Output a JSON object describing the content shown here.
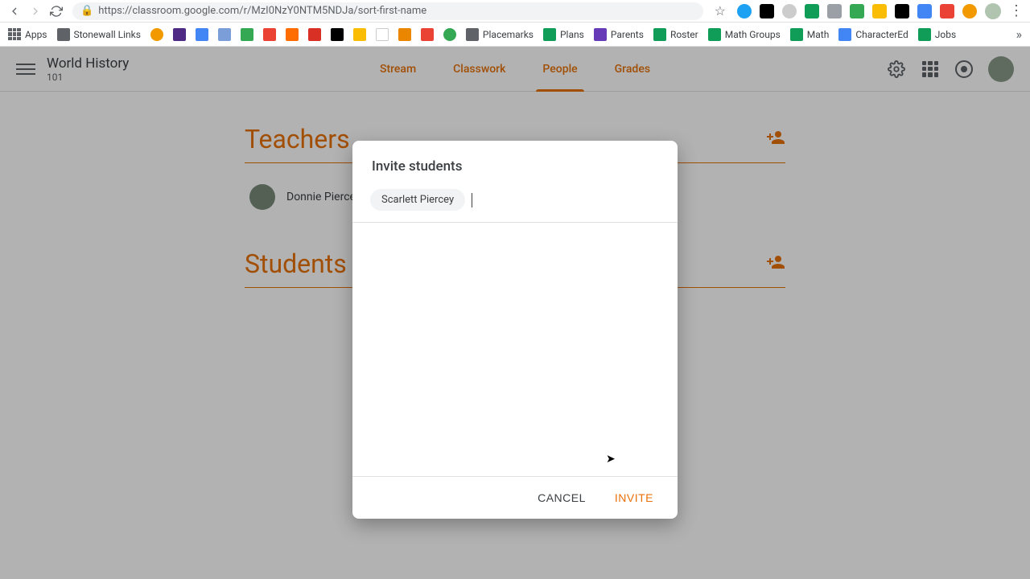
{
  "browser": {
    "url": "https://classroom.google.com/r/MzI0NzY0NTM5NDJa/sort-first-name",
    "bookmarks": [
      {
        "label": "Apps",
        "color": ""
      },
      {
        "label": "Stonewall Links",
        "color": "#5f6368"
      },
      {
        "label": "",
        "color": "#f29900"
      },
      {
        "label": "",
        "color": "#4f2a84"
      },
      {
        "label": "",
        "color": "#4285f4"
      },
      {
        "label": "",
        "color": "#7b9ed9"
      },
      {
        "label": "",
        "color": "#34a853"
      },
      {
        "label": "",
        "color": "#ea4335"
      },
      {
        "label": "",
        "color": "#ff6d00"
      },
      {
        "label": "",
        "color": "#d93025"
      },
      {
        "label": "",
        "color": "#000"
      },
      {
        "label": "",
        "color": "#fbbc04"
      },
      {
        "label": "",
        "color": "#fff"
      },
      {
        "label": "",
        "color": "#ea8600"
      },
      {
        "label": "",
        "color": "#ea4335"
      },
      {
        "label": "",
        "color": "#34a853"
      },
      {
        "label": "Placemarks",
        "color": "#5f6368"
      },
      {
        "label": "Plans",
        "color": "#0f9d58"
      },
      {
        "label": "Parents",
        "color": "#673ab7"
      },
      {
        "label": "Roster",
        "color": "#0f9d58"
      },
      {
        "label": "Math Groups",
        "color": "#0f9d58"
      },
      {
        "label": "Math",
        "color": "#0f9d58"
      },
      {
        "label": "CharacterEd",
        "color": "#4285f4"
      },
      {
        "label": "Jobs",
        "color": "#0f9d58"
      }
    ]
  },
  "header": {
    "classTitle": "World History",
    "classSub": "101",
    "tabs": {
      "stream": "Stream",
      "classwork": "Classwork",
      "people": "People",
      "grades": "Grades"
    }
  },
  "people": {
    "teachersTitle": "Teachers",
    "studentsTitle": "Students",
    "teacherName": "Donnie Piercey"
  },
  "modal": {
    "title": "Invite students",
    "chip": "Scarlett Piercey",
    "cancel": "CANCEL",
    "invite": "INVITE"
  }
}
